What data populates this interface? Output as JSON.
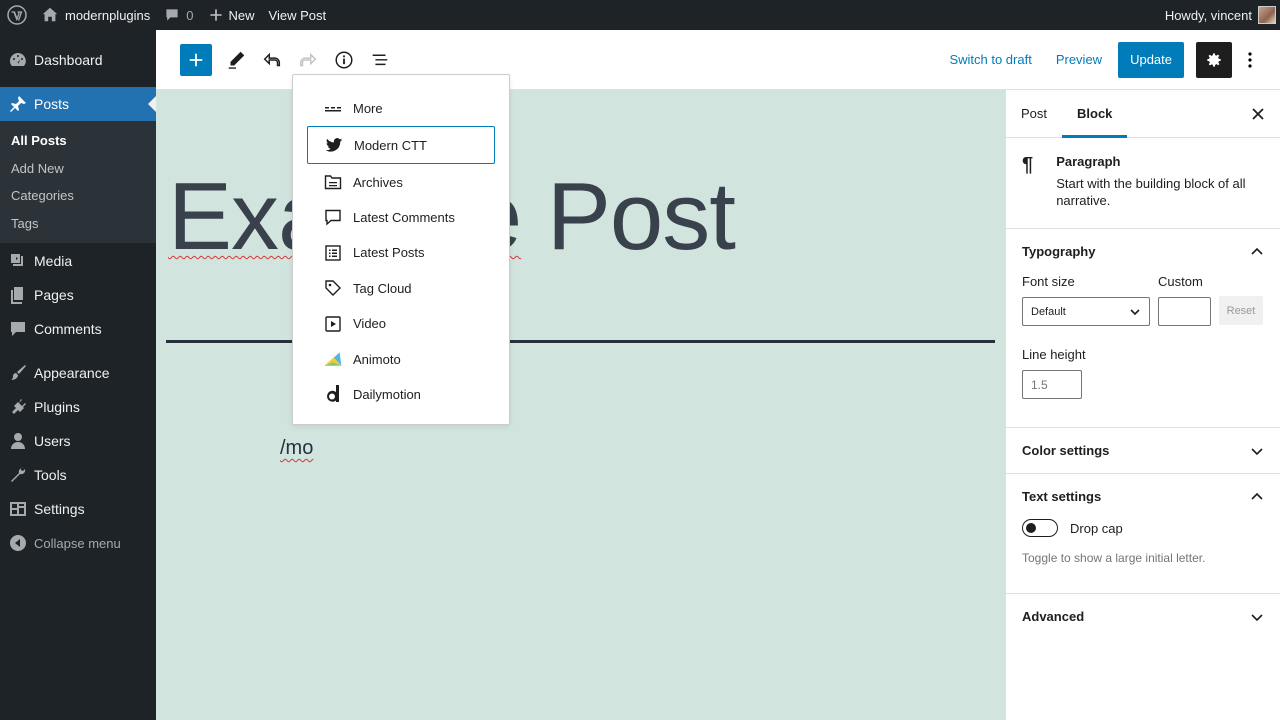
{
  "admin_bar": {
    "site_name": "modernplugins",
    "comments_count": "0",
    "new_label": "New",
    "view_post_label": "View Post",
    "howdy": "Howdy, vincent"
  },
  "sidebar": {
    "items": [
      {
        "label": "Dashboard",
        "icon": "dashboard-icon"
      },
      {
        "label": "Posts",
        "icon": "pin-icon"
      },
      {
        "label": "Media",
        "icon": "media-icon"
      },
      {
        "label": "Pages",
        "icon": "pages-icon"
      },
      {
        "label": "Comments",
        "icon": "comment-icon"
      },
      {
        "label": "Appearance",
        "icon": "brush-icon"
      },
      {
        "label": "Plugins",
        "icon": "plugin-icon"
      },
      {
        "label": "Users",
        "icon": "user-icon"
      },
      {
        "label": "Tools",
        "icon": "wrench-icon"
      },
      {
        "label": "Settings",
        "icon": "settings-icon"
      }
    ],
    "posts_submenu": [
      "All Posts",
      "Add New",
      "Categories",
      "Tags"
    ],
    "collapse_label": "Collapse menu"
  },
  "toolbar": {
    "switch_to_draft": "Switch to draft",
    "preview": "Preview",
    "update": "Update"
  },
  "editor": {
    "title_part1": "Exa",
    "title_part2": "le",
    "title_part3": "Post",
    "paragraph_text": "/mo"
  },
  "autocomplete": {
    "options": [
      {
        "label": "More",
        "icon": "more-icon"
      },
      {
        "label": "Modern CTT",
        "icon": "twitter-icon"
      },
      {
        "label": "Archives",
        "icon": "archive-icon"
      },
      {
        "label": "Latest Comments",
        "icon": "comment-icon"
      },
      {
        "label": "Latest Posts",
        "icon": "list-icon"
      },
      {
        "label": "Tag Cloud",
        "icon": "tag-icon"
      },
      {
        "label": "Video",
        "icon": "video-icon"
      },
      {
        "label": "Animoto",
        "icon": "animoto-icon"
      },
      {
        "label": "Dailymotion",
        "icon": "dailymotion-icon"
      }
    ],
    "selected_index": 1
  },
  "settings_panel": {
    "tabs": [
      "Post",
      "Block"
    ],
    "active_tab": "Block",
    "block_name": "Paragraph",
    "block_desc": "Start with the building block of all narrative.",
    "typography": {
      "title": "Typography",
      "font_size_label": "Font size",
      "custom_label": "Custom",
      "font_size_value": "Default",
      "reset_label": "Reset",
      "line_height_label": "Line height",
      "line_height_placeholder": "1.5"
    },
    "color_settings": "Color settings",
    "text_settings": {
      "title": "Text settings",
      "drop_cap_label": "Drop cap",
      "help": "Toggle to show a large initial letter."
    },
    "advanced": "Advanced"
  },
  "colors": {
    "admin_bg": "#1d2327",
    "accent": "#007cba",
    "canvas_bg": "#d1e4dd"
  }
}
